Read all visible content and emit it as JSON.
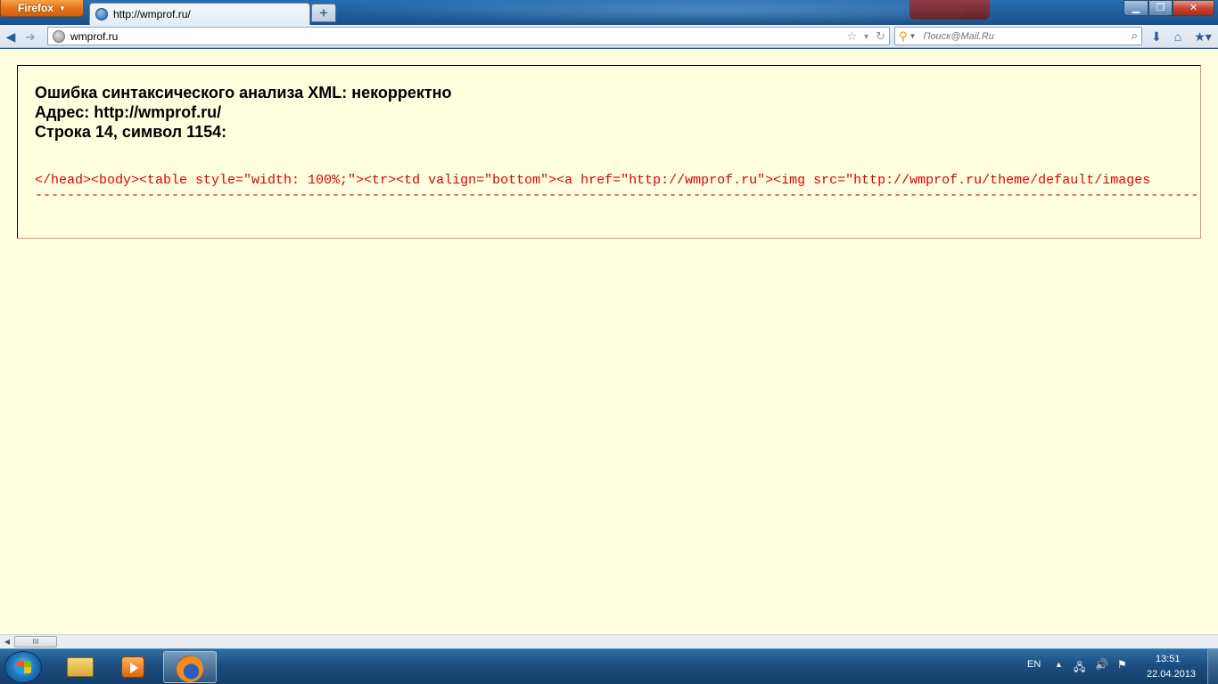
{
  "browser": {
    "firefox_button_label": "Firefox",
    "tab_title": "http://wmprof.ru/",
    "new_tab_symbol": "+",
    "url": "wmprof.ru",
    "search_placeholder": "Поиск@Mail.Ru"
  },
  "error": {
    "heading_line1": "Ошибка синтаксического анализа XML: некорректно",
    "heading_line2": "Адрес: http://wmprof.ru/",
    "heading_line3": "Строка 14, символ 1154:",
    "source_text": "</head><body><table style=\"width: 100%;\"><tr><td valign=\"bottom\"><a href=\"http://wmprof.ru\"><img src=\"http://wmprof.ru/theme/default/images",
    "marker_line": "------------------------------------------------------------------------------------------------------------------------------------------------------"
  },
  "scrollbar": {
    "thumb_grip": "III"
  },
  "taskbar": {
    "language": "EN",
    "time": "13:51",
    "date": "22.04.2013"
  },
  "icons": {
    "back": "back-arrow-icon",
    "forward": "forward-arrow-icon",
    "bookmark_star": "star-icon",
    "reload": "reload-icon",
    "search_engine": "mail-ru-search-icon",
    "search_go": "magnifier-icon",
    "downloads": "download-arrow-icon",
    "home": "home-icon",
    "bookmarks": "bookmarks-icon"
  },
  "colors": {
    "page_background": "#ffffe0",
    "error_text": "#e00000",
    "firefox_orange": "#e4761c"
  }
}
